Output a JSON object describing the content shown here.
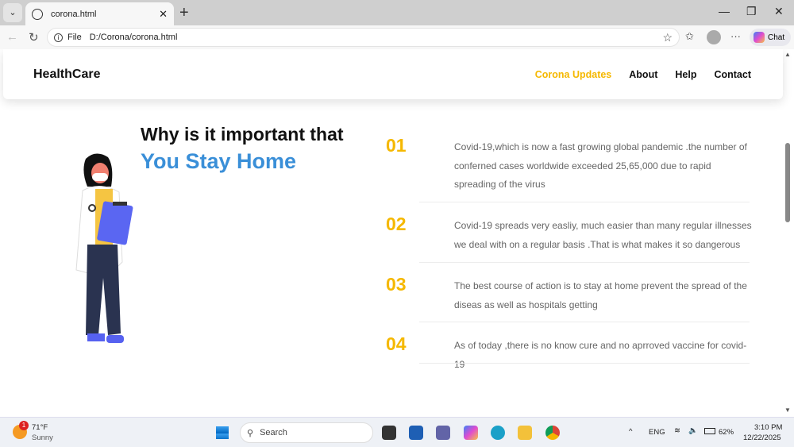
{
  "browser": {
    "tab_title": "corona.html",
    "url_scheme": "File",
    "url": "D:/Corona/corona.html",
    "chat_label": "Chat"
  },
  "nav": {
    "brand": "HealthCare",
    "items": [
      {
        "label": "Corona Updates",
        "active": true
      },
      {
        "label": "About"
      },
      {
        "label": "Help"
      },
      {
        "label": "Contact"
      }
    ]
  },
  "hero": {
    "title_line1": "Why is it important that",
    "title_line2": "You Stay Home"
  },
  "points": [
    {
      "num": "01",
      "text": "Covid-19,which is now a fast growing global pandemic .the number of conferned cases worldwide exceeded 25,65,000 due to rapid spreading of the virus"
    },
    {
      "num": "02",
      "text": "Covid-19 spreads very easliy, much easier than many regular illnesses we deal with on a regular basis .That is what makes it so dangerous"
    },
    {
      "num": "03",
      "text": "The best course of action is to stay at home prevent the spread of the diseas as well as hospitals getting"
    },
    {
      "num": "04",
      "text": "As of today ,there is no know cure and no aprroved vaccine for covid-19"
    }
  ],
  "colors": {
    "accent": "#f5b800",
    "blue": "#3a8fd8"
  },
  "taskbar": {
    "weather_temp": "71°F",
    "weather_desc": "Sunny",
    "weather_badge": "1",
    "search": "Search",
    "lang": "ENG",
    "battery": "62%",
    "time": "3:10 PM",
    "date": "12/22/2025"
  }
}
